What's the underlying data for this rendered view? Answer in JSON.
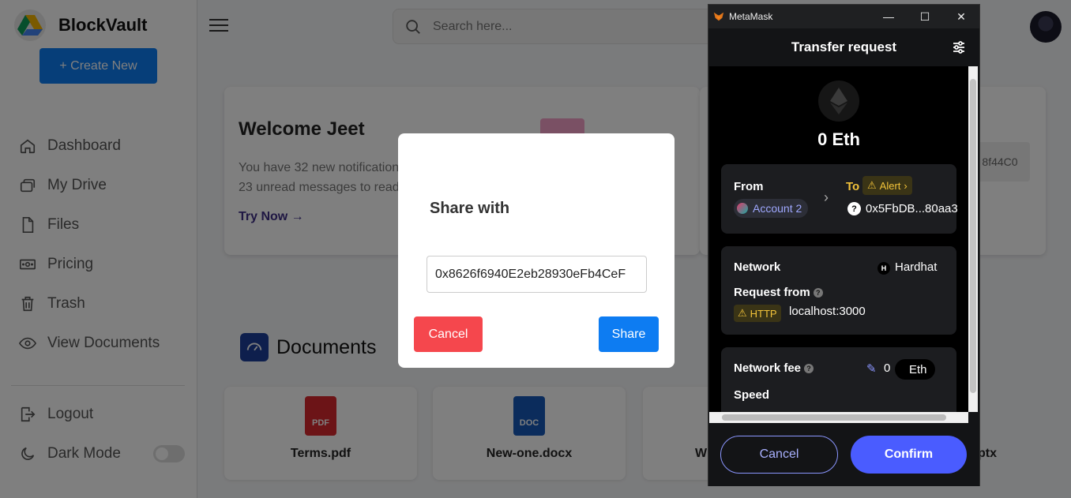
{
  "sidebar": {
    "brand": "BlockVault",
    "create_label": "+ Create New",
    "nav": [
      "Dashboard",
      "My Drive",
      "Files",
      "Pricing",
      "Trash",
      "View Documents"
    ],
    "logout": "Logout",
    "dark_mode": "Dark Mode",
    "dark_mode_on": false
  },
  "topbar": {
    "search_placeholder": "Search here..."
  },
  "welcome": {
    "title": "Welcome Jeet",
    "line1": "You have 32 new notifications and",
    "line2": "23 unread messages to read",
    "cta": "Try Now →"
  },
  "address_chip": "8f44C0",
  "documents": {
    "title": "Documents",
    "files": [
      {
        "name": "Terms.pdf",
        "type": "PDF",
        "color": "#d9282f"
      },
      {
        "name": "New-one.docx",
        "type": "DOC",
        "color": "#1659b8"
      }
    ],
    "partial_left": "W",
    "partial_right": "ptx"
  },
  "share_modal": {
    "title": "Share with",
    "input_value": "0x8626f6940E2eb28930eFb4CeF",
    "cancel": "Cancel",
    "share": "Share"
  },
  "metamask": {
    "window_title": "MetaMask",
    "header": "Transfer request",
    "amount": "0 Eth",
    "from_label": "From",
    "to_label": "To",
    "alert_label": "Alert",
    "from_account": "Account 2",
    "to_address": "0x5FbDB...80aa3",
    "network_label": "Network",
    "network_value": "Hardhat",
    "network_badge": "H",
    "request_from_label": "Request from",
    "protocol": "HTTP",
    "origin": "localhost:3000",
    "fee_label": "Network fee",
    "fee_value": "0",
    "fee_unit": "Eth",
    "speed_label": "Speed",
    "cancel": "Cancel",
    "confirm": "Confirm"
  }
}
